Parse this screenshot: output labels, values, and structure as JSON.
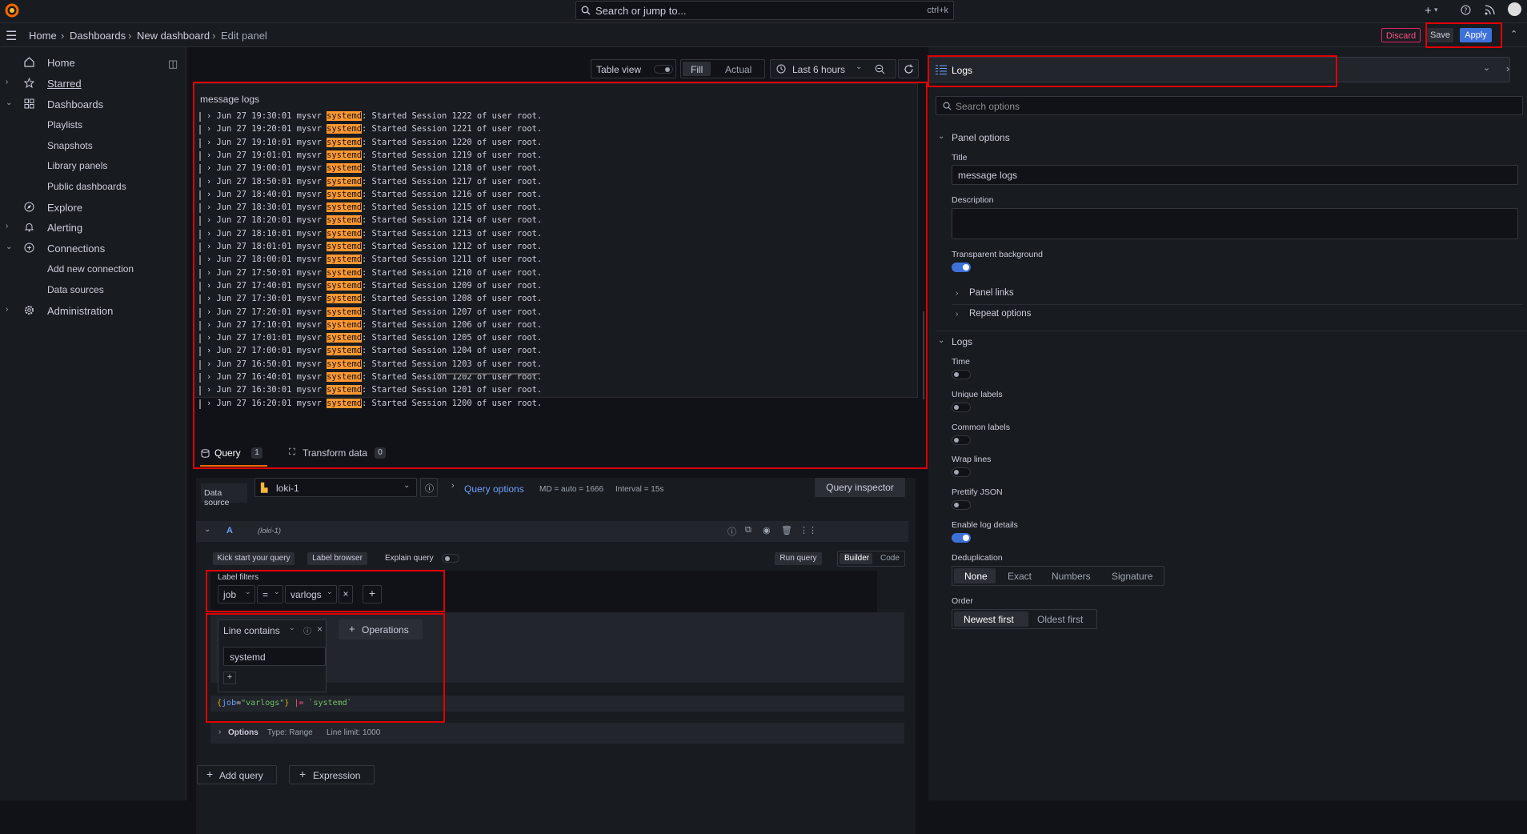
{
  "topbar": {
    "search_placeholder": "Search or jump to...",
    "shortcut": "ctrl+k",
    "add_label": "+"
  },
  "breadcrumb": [
    "Home",
    "Dashboards",
    "New dashboard",
    "Edit panel"
  ],
  "actions": {
    "discard": "Discard",
    "save": "Save",
    "apply": "Apply"
  },
  "sidebar": {
    "home": "Home",
    "starred": "Starred",
    "dashboards": "Dashboards",
    "playlists": "Playlists",
    "snapshots": "Snapshots",
    "library_panels": "Library panels",
    "public_dashboards": "Public dashboards",
    "explore": "Explore",
    "alerting": "Alerting",
    "connections": "Connections",
    "add_new_connection": "Add new connection",
    "data_sources": "Data sources",
    "administration": "Administration"
  },
  "toolbar": {
    "table_view": "Table view",
    "fill": "Fill",
    "actual": "Actual",
    "time_range": "Last 6 hours"
  },
  "panel": {
    "title": "message logs",
    "logs": [
      {
        "time": "Jun 27 19:30:01",
        "session": "1222"
      },
      {
        "time": "Jun 27 19:20:01",
        "session": "1221"
      },
      {
        "time": "Jun 27 19:10:01",
        "session": "1220"
      },
      {
        "time": "Jun 27 19:01:01",
        "session": "1219"
      },
      {
        "time": "Jun 27 19:00:01",
        "session": "1218"
      },
      {
        "time": "Jun 27 18:50:01",
        "session": "1217"
      },
      {
        "time": "Jun 27 18:40:01",
        "session": "1216"
      },
      {
        "time": "Jun 27 18:30:01",
        "session": "1215"
      },
      {
        "time": "Jun 27 18:20:01",
        "session": "1214"
      },
      {
        "time": "Jun 27 18:10:01",
        "session": "1213"
      },
      {
        "time": "Jun 27 18:01:01",
        "session": "1212"
      },
      {
        "time": "Jun 27 18:00:01",
        "session": "1211"
      },
      {
        "time": "Jun 27 17:50:01",
        "session": "1210"
      },
      {
        "time": "Jun 27 17:40:01",
        "session": "1209"
      },
      {
        "time": "Jun 27 17:30:01",
        "session": "1208"
      },
      {
        "time": "Jun 27 17:20:01",
        "session": "1207"
      },
      {
        "time": "Jun 27 17:10:01",
        "session": "1206"
      },
      {
        "time": "Jun 27 17:01:01",
        "session": "1205"
      },
      {
        "time": "Jun 27 17:00:01",
        "session": "1204"
      },
      {
        "time": "Jun 27 16:50:01",
        "session": "1203"
      },
      {
        "time": "Jun 27 16:40:01",
        "session": "1202"
      },
      {
        "time": "Jun 27 16:30:01",
        "session": "1201"
      },
      {
        "time": "Jun 27 16:20:01",
        "session": "1200"
      }
    ],
    "log_host": "mysvr",
    "log_unit": "systemd",
    "log_msg_prefix": ": Started Session ",
    "log_msg_suffix": " of user root."
  },
  "tabs": {
    "query": "Query",
    "query_count": "1",
    "transform": "Transform data",
    "transform_count": "0"
  },
  "datasource": {
    "label": "Data source",
    "name": "loki-1",
    "query_options": "Query options",
    "md": "MD = auto = 1666",
    "interval": "Interval = 15s",
    "inspector": "Query inspector"
  },
  "query": {
    "letter": "A",
    "ds_hint": "(loki-1)",
    "kick_start": "Kick start your query",
    "label_browser": "Label browser",
    "explain": "Explain query",
    "run": "Run query",
    "builder": "Builder",
    "code": "Code",
    "label_filters": "Label filters",
    "filter_label": "job",
    "filter_op": "=",
    "filter_value": "varlogs",
    "operation": "Line contains",
    "operation_value": "systemd",
    "operations_btn": "Operations",
    "expr_brace_open": "{",
    "expr_label": "job",
    "expr_eq": "=",
    "expr_value": "\"varlogs\"",
    "expr_brace_close": "}",
    "expr_op": "|=",
    "expr_str": "`systemd`",
    "options": "Options",
    "type": "Type: Range",
    "limit": "Line limit: 1000",
    "add_query": "Add query",
    "expression": "Expression"
  },
  "options_pane": {
    "viz": "Logs",
    "search_placeholder": "Search options",
    "panel_options": "Panel options",
    "title_label": "Title",
    "title_value": "message logs",
    "description_label": "Description",
    "transparent": "Transparent background",
    "panel_links": "Panel links",
    "repeat_options": "Repeat options",
    "logs_section": "Logs",
    "time": "Time",
    "unique_labels": "Unique labels",
    "common_labels": "Common labels",
    "wrap_lines": "Wrap lines",
    "prettify_json": "Prettify JSON",
    "enable_log_details": "Enable log details",
    "dedup": "Deduplication",
    "dedup_opts": [
      "None",
      "Exact",
      "Numbers",
      "Signature"
    ],
    "order": "Order",
    "order_opts": [
      "Newest first",
      "Oldest first"
    ]
  }
}
